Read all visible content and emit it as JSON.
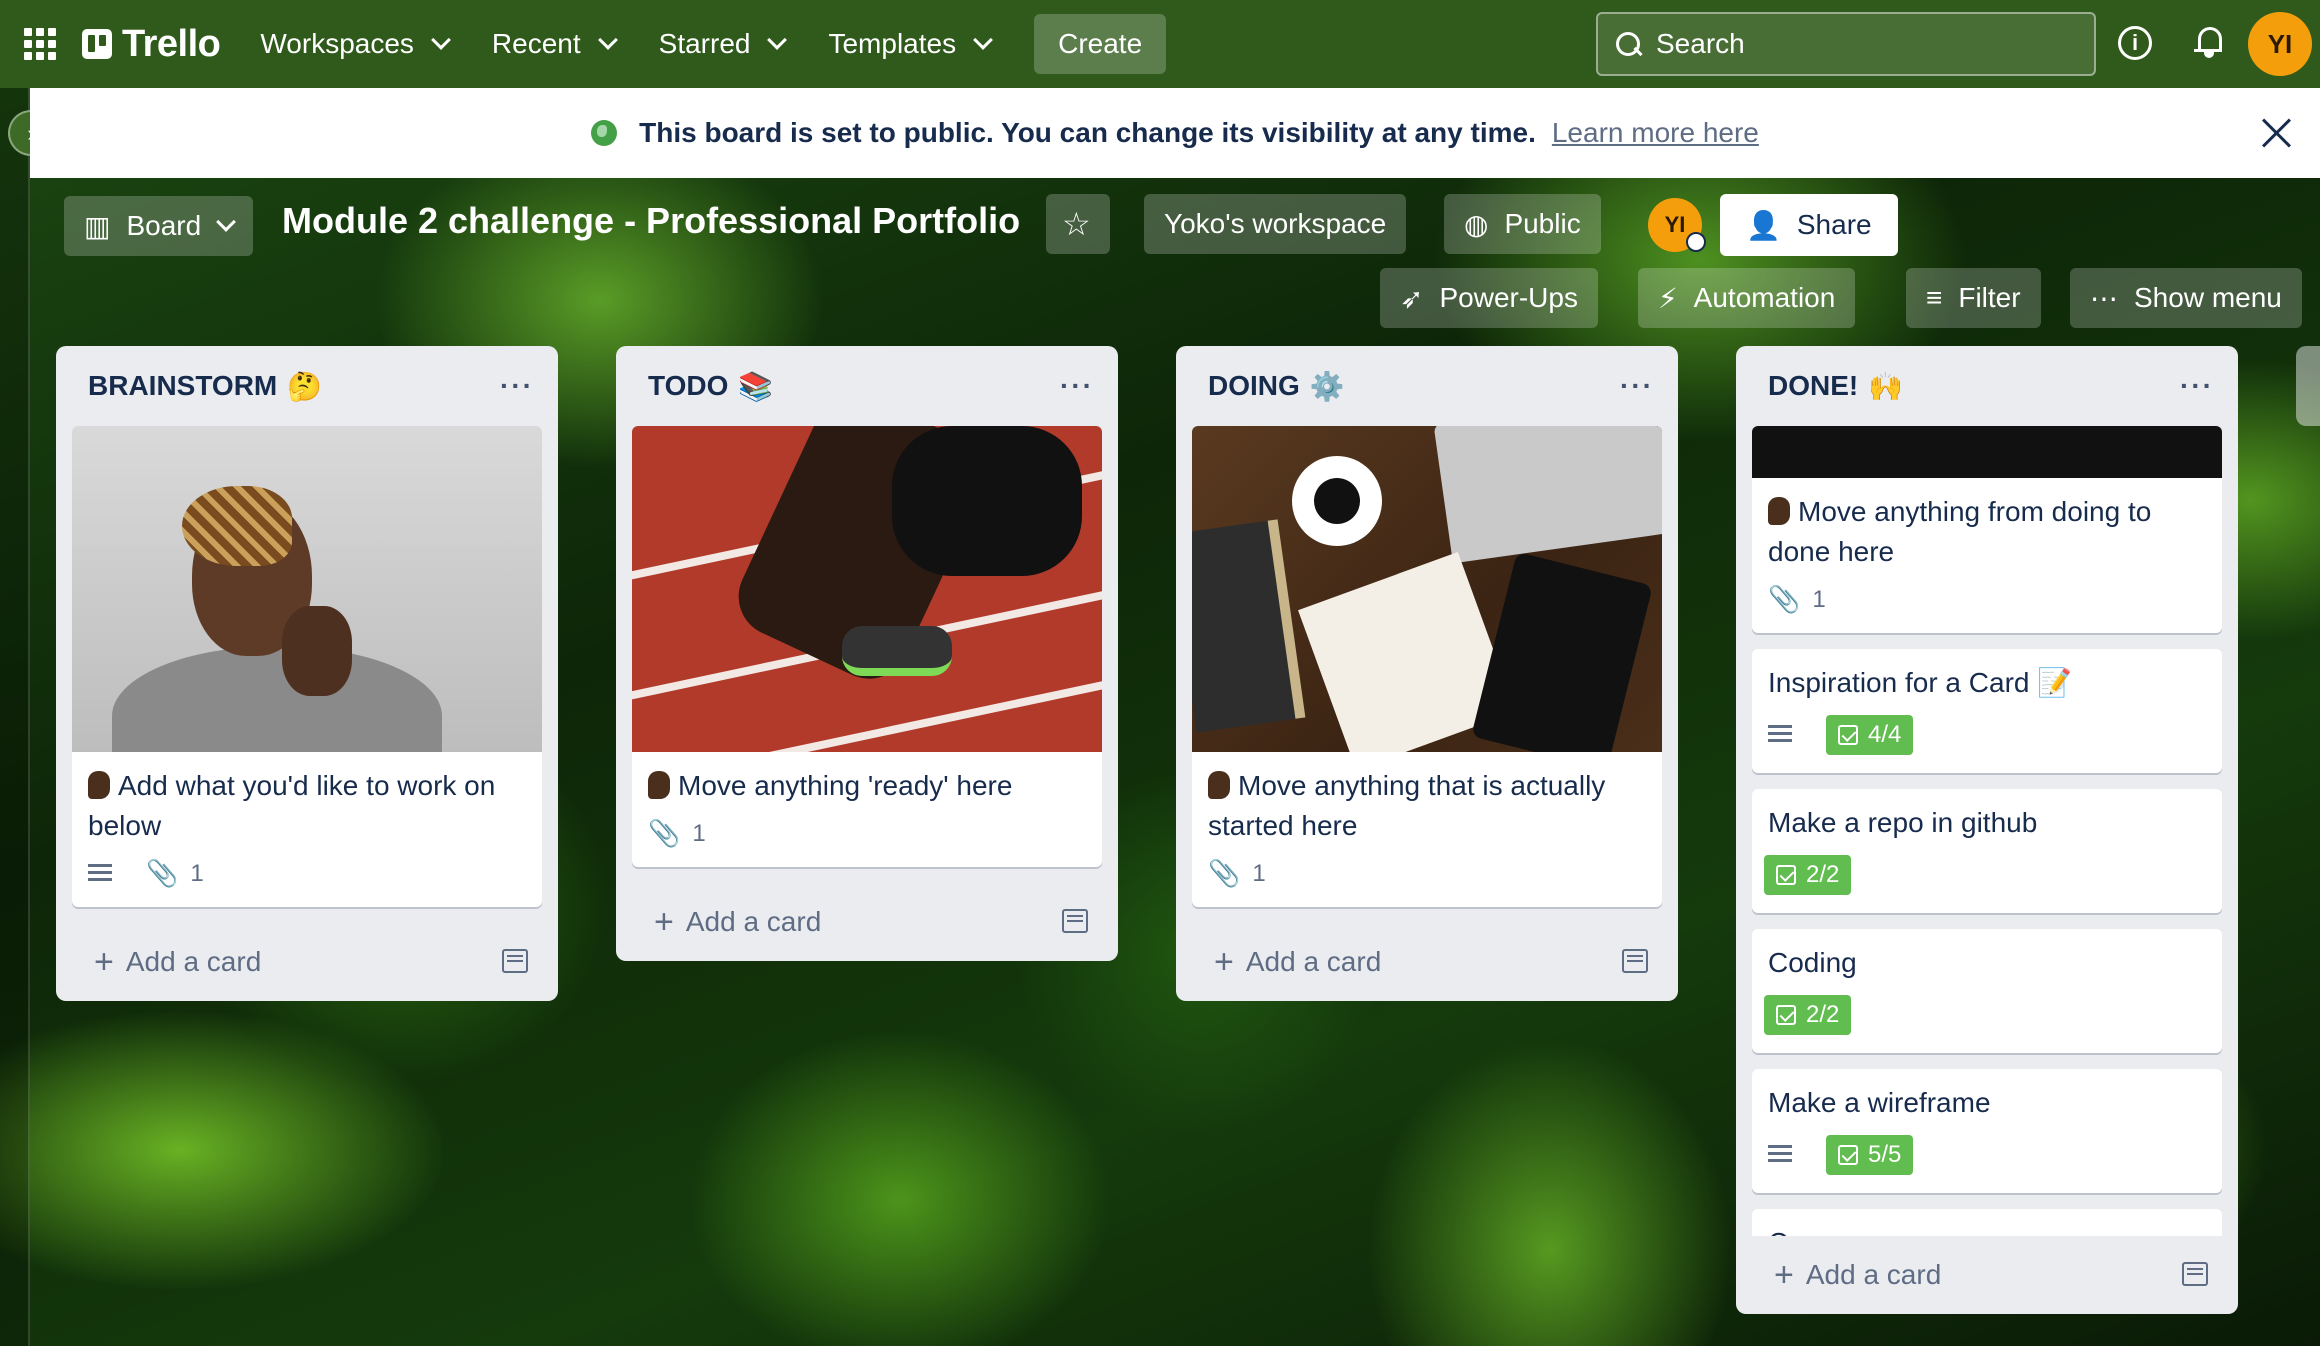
{
  "topnav": {
    "logo": "Trello",
    "menus": [
      "Workspaces",
      "Recent",
      "Starred",
      "Templates"
    ],
    "create": "Create",
    "search_placeholder": "Search",
    "avatar": "YI"
  },
  "banner": {
    "text": "This board is set to public. You can change its visibility at any time.",
    "link": "Learn more here"
  },
  "board": {
    "view": "Board",
    "title": "Module 2 challenge - Professional Portfolio",
    "workspace": "Yoko's workspace",
    "visibility": "Public",
    "avatar": "YI",
    "share": "Share",
    "powerups": "Power-Ups",
    "automation": "Automation",
    "filter": "Filter",
    "show_menu": "Show menu"
  },
  "lists": [
    {
      "title": "BRAINSTORM",
      "emoji": "🤔",
      "card": {
        "title": "Add what you'd like to work on below",
        "attachments": "1"
      },
      "add": "Add a card"
    },
    {
      "title": "TODO",
      "emoji": "📚",
      "card": {
        "title": "Move anything 'ready' here",
        "attachments": "1"
      },
      "add": "Add a card"
    },
    {
      "title": "DOING",
      "emoji": "⚙️",
      "card": {
        "title": "Move anything that is actually started here",
        "attachments": "1"
      },
      "add": "Add a card"
    },
    {
      "title": "DONE!",
      "emoji": "🙌",
      "cards": [
        {
          "title": "Move anything from doing to done here",
          "attachments": "1"
        },
        {
          "title": "Inspiration for a Card 📝",
          "checklist": "4/4"
        },
        {
          "title": "Make a repo in github",
          "checklist": "2/2"
        },
        {
          "title": "Coding",
          "checklist": "2/2"
        },
        {
          "title": "Make a wireframe",
          "checklist": "5/5"
        },
        {
          "title": "Css"
        }
      ],
      "add": "Add a card"
    }
  ],
  "colors": {
    "nav": "#2f5a1b",
    "list": "#ebecf0",
    "checklist_complete": "#61bd4f",
    "avatar": "#f59e0b"
  }
}
